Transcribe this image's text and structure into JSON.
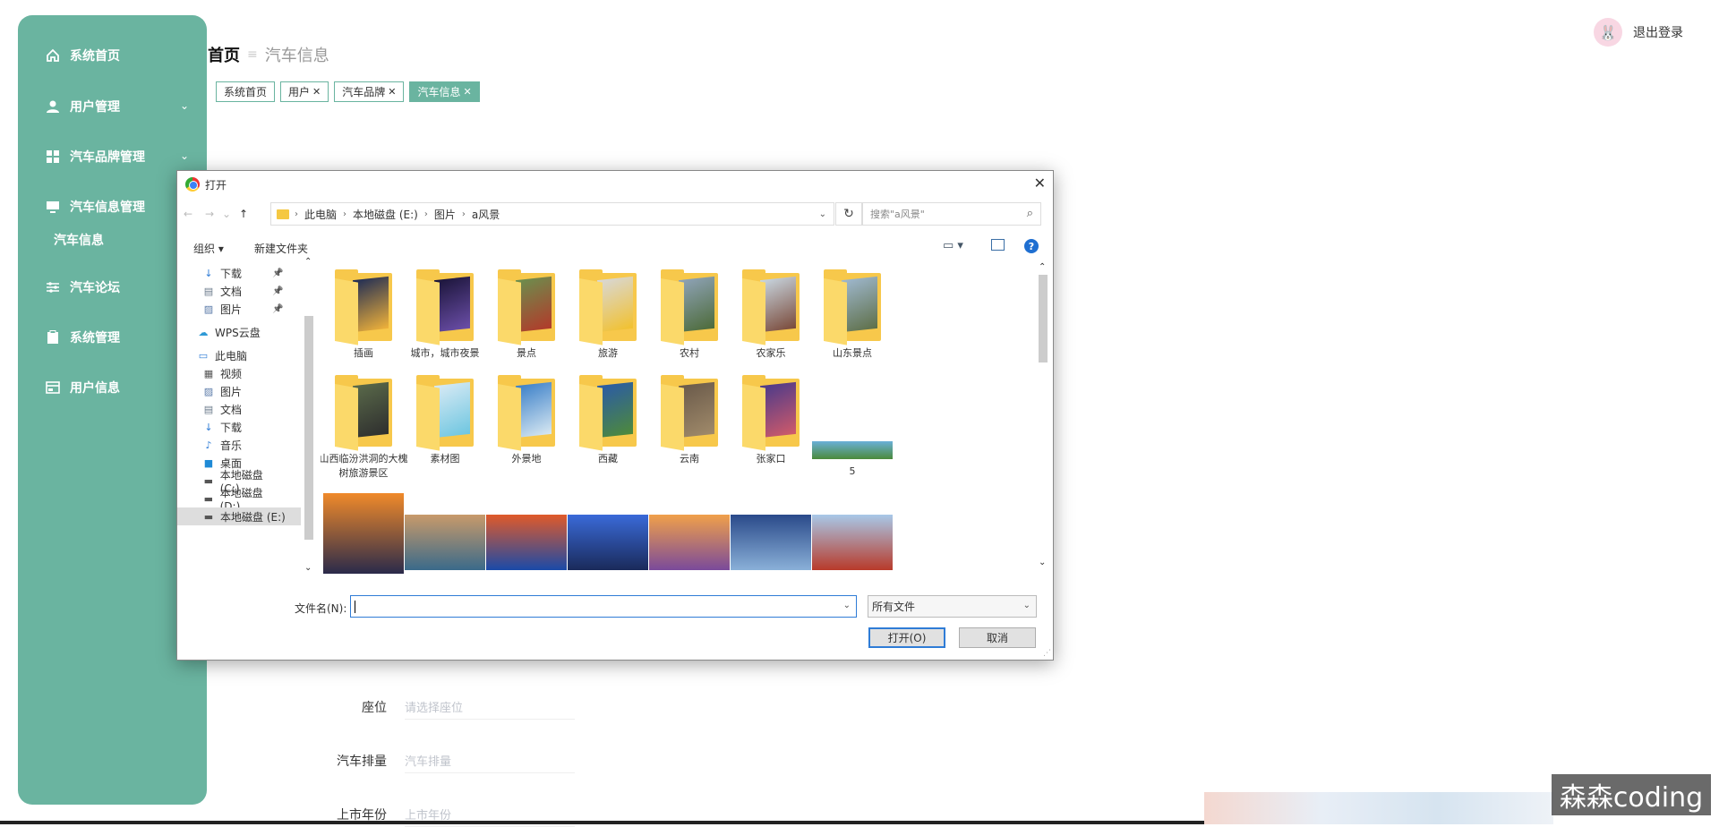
{
  "sidebar": {
    "items": [
      {
        "label": "系统首页",
        "icon": "home-icon"
      },
      {
        "label": "用户管理",
        "icon": "user-icon",
        "chevron": "⌄"
      },
      {
        "label": "汽车品牌管理",
        "icon": "grid-icon",
        "chevron": "⌄"
      },
      {
        "label": "汽车信息管理",
        "icon": "monitor-icon"
      },
      {
        "label": "汽车论坛",
        "icon": "sliders-icon"
      },
      {
        "label": "系统管理",
        "icon": "clipboard-icon"
      },
      {
        "label": "用户信息",
        "icon": "card-icon"
      }
    ],
    "submenu": {
      "label": "汽车信息"
    },
    "colors": {
      "bg": "#6ab4a0",
      "text": "#ffffff"
    }
  },
  "breadcrumb": {
    "home": "首页",
    "separator": "≡",
    "current": "汽车信息"
  },
  "tags": [
    {
      "label": "系统首页",
      "closable": false
    },
    {
      "label": "用户",
      "closable": true
    },
    {
      "label": "汽车品牌",
      "closable": true
    },
    {
      "label": "汽车信息",
      "closable": true,
      "active": true
    }
  ],
  "header": {
    "logout": "退出登录"
  },
  "form": [
    {
      "label": "座位",
      "placeholder": "请选择座位"
    },
    {
      "label": "汽车排量",
      "placeholder": "汽车排量"
    },
    {
      "label": "上市年份",
      "placeholder": "上市年份"
    }
  ],
  "watermark": "森森coding",
  "dialog": {
    "title": "打开",
    "close": "✕",
    "nav": {
      "back": "←",
      "forward": "→",
      "recent": "⌄",
      "up": "↑"
    },
    "address": [
      "此电脑",
      "本地磁盘 (E:)",
      "图片",
      "a风景"
    ],
    "address_sep": "›",
    "refresh": "↻",
    "search_placeholder": "搜索\"a风景\"",
    "toolbar": {
      "organize": "组织 ▾",
      "new_folder": "新建文件夹",
      "help": "?"
    },
    "tree": [
      {
        "label": "下载",
        "icon": "download-icon",
        "pinned": true
      },
      {
        "label": "文档",
        "icon": "document-icon",
        "pinned": true
      },
      {
        "label": "图片",
        "icon": "picture-icon",
        "pinned": true
      },
      {
        "label": "WPS云盘",
        "icon": "cloud-icon"
      },
      {
        "label": "此电脑",
        "icon": "computer-icon"
      },
      {
        "label": "视频",
        "icon": "video-icon"
      },
      {
        "label": "图片",
        "icon": "picture-icon"
      },
      {
        "label": "文档",
        "icon": "document-icon"
      },
      {
        "label": "下载",
        "icon": "download-icon"
      },
      {
        "label": "音乐",
        "icon": "music-icon"
      },
      {
        "label": "桌面",
        "icon": "desktop-icon"
      },
      {
        "label": "本地磁盘 (C:)",
        "icon": "drive-icon"
      },
      {
        "label": "本地磁盘 (D:)",
        "icon": "drive-icon"
      },
      {
        "label": "本地磁盘 (E:)",
        "icon": "drive-icon",
        "selected": true
      }
    ],
    "folders": [
      {
        "label": "插画",
        "c1": "#1d2b55",
        "c2": "#f0b23a"
      },
      {
        "label": "城市，城市夜景",
        "c1": "#1a1438",
        "c2": "#6b4ea8"
      },
      {
        "label": "景点",
        "c1": "#6b8f4e",
        "c2": "#b23a2a"
      },
      {
        "label": "旅游",
        "c1": "#d8d8d8",
        "c2": "#f2c12e"
      },
      {
        "label": "农村",
        "c1": "#8fa3b8",
        "c2": "#4d6b3a"
      },
      {
        "label": "农家乐",
        "c1": "#c8d6e0",
        "c2": "#7a4a3a"
      },
      {
        "label": "山东景点",
        "c1": "#9fb8cf",
        "c2": "#5e6f48"
      },
      {
        "label": "山西临汾洪洞的大槐树旅游景区",
        "c1": "#5a6a4a",
        "c2": "#2e2e2e"
      },
      {
        "label": "素材图",
        "c1": "#d8eaf5",
        "c2": "#6ec6e0"
      },
      {
        "label": "外景地",
        "c1": "#3a7fc8",
        "c2": "#d8e8f2"
      },
      {
        "label": "西藏",
        "c1": "#2a5aa8",
        "c2": "#4e8a3a"
      },
      {
        "label": "云南",
        "c1": "#6a5a4a",
        "c2": "#a08a6a"
      },
      {
        "label": "张家口",
        "c1": "#4a3a8a",
        "c2": "#d05a6a"
      }
    ],
    "images": [
      {
        "label": "5",
        "c1": "#6ab0d8",
        "c2": "#4a8a3a"
      },
      {
        "label": "",
        "c1": "#f08a2a",
        "c2": "#2a2a4a"
      },
      {
        "label": "",
        "c1": "#c89a6a",
        "c2": "#3a6a8a"
      },
      {
        "label": "",
        "c1": "#e05a2a",
        "c2": "#1a4aa8"
      },
      {
        "label": "",
        "c1": "#3a6ad8",
        "c2": "#1a2a5a"
      },
      {
        "label": "",
        "c1": "#f0a04a",
        "c2": "#7a4a9a"
      },
      {
        "label": "",
        "c1": "#2a4a8a",
        "c2": "#8ab0d8"
      },
      {
        "label": "",
        "c1": "#a8c8e8",
        "c2": "#b83a2a"
      }
    ],
    "filename_label": "文件名(N):",
    "filename_value": "",
    "filetype": "所有文件",
    "open": "打开(O)",
    "cancel": "取消"
  }
}
